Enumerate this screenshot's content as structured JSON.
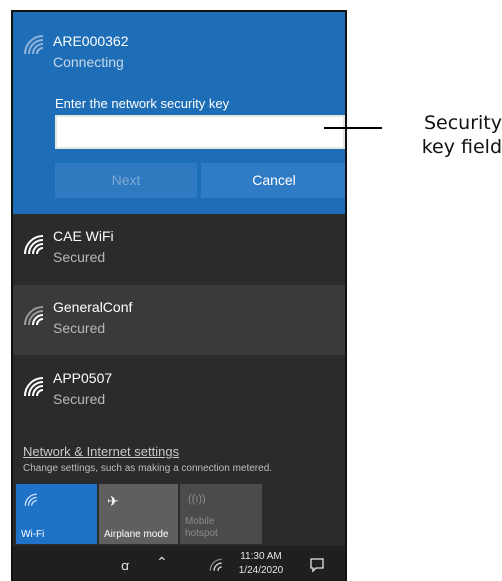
{
  "connecting_network": {
    "name": "ARE000362",
    "status": "Connecting",
    "key_label": "Enter the network security key",
    "key_value": "",
    "next_label": "Next",
    "cancel_label": "Cancel",
    "icon": "wifi-signal-icon"
  },
  "networks": [
    {
      "name": "CAE WiFi",
      "status": "Secured",
      "icon": "wifi-signal-icon"
    },
    {
      "name": "GeneralConf",
      "status": "Secured",
      "icon": "wifi-signal-icon"
    },
    {
      "name": "APP0507",
      "status": "Secured",
      "icon": "wifi-signal-icon"
    }
  ],
  "settings": {
    "link": "Network & Internet settings",
    "description": "Change settings, such as making a connection metered."
  },
  "tiles": [
    {
      "label": "Wi-Fi",
      "icon": "wifi-icon",
      "active": true
    },
    {
      "label": "Airplane mode",
      "icon": "airplane-icon",
      "active": false
    },
    {
      "label_line1": "Mobile",
      "label_line2": "hotspot",
      "icon": "hotspot-icon",
      "active": false
    }
  ],
  "taskbar": {
    "time": "11:30 AM",
    "date": "1/24/2020"
  },
  "callout": {
    "line1": "Security",
    "line2": "key field"
  },
  "colors": {
    "accent": "#1e6db7",
    "panel": "#2b2b2b",
    "taskbar": "#1f1f1f"
  }
}
